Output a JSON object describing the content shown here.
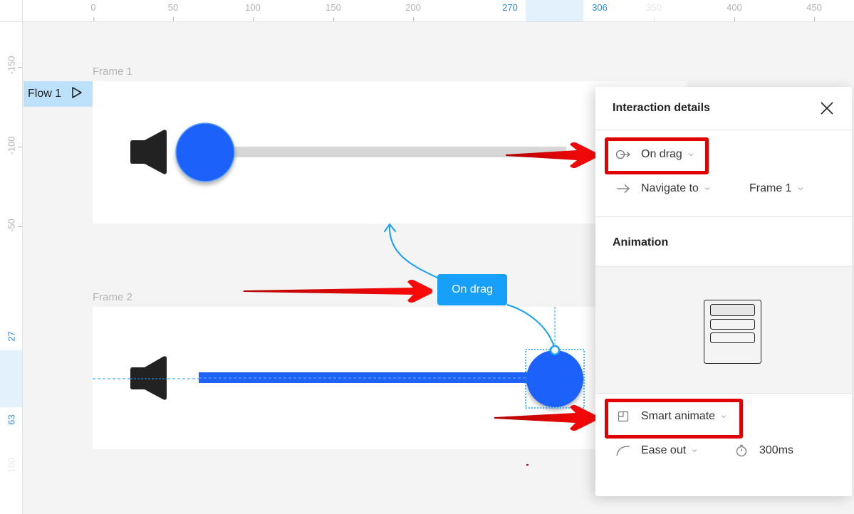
{
  "ruler": {
    "horizontal_ticks": [
      "0",
      "50",
      "100",
      "150",
      "200",
      "350",
      "400",
      "450"
    ],
    "horizontal_selection": {
      "start": "270",
      "end": "306"
    },
    "vertical_ticks": [
      "-150",
      "-100",
      "-50",
      "100"
    ],
    "vertical_selection": {
      "start": "27",
      "end": "63"
    }
  },
  "canvas": {
    "frames": [
      {
        "label": "Frame 1"
      },
      {
        "label": "Frame 2"
      }
    ],
    "flow": {
      "label": "Flow 1",
      "icon": "play-icon"
    },
    "connector_label": "On drag",
    "colors": {
      "knob": "#1e62fa",
      "track_inactive": "#d6d6d6",
      "track_active": "#1e62fa",
      "connector": "#17a0fa",
      "annotation": "#e00000"
    }
  },
  "panel": {
    "title": "Interaction details",
    "trigger": {
      "icon": "drag-trigger-icon",
      "label": "On drag"
    },
    "action": {
      "icon": "arrow-right-icon",
      "label": "Navigate to"
    },
    "destination": {
      "label": "Frame 1"
    },
    "animation_title": "Animation",
    "animation_type": {
      "icon": "smart-animate-icon",
      "label": "Smart animate"
    },
    "easing": {
      "icon": "ease-curve-icon",
      "label": "Ease out"
    },
    "duration": {
      "icon": "timer-icon",
      "label": "300ms"
    }
  }
}
